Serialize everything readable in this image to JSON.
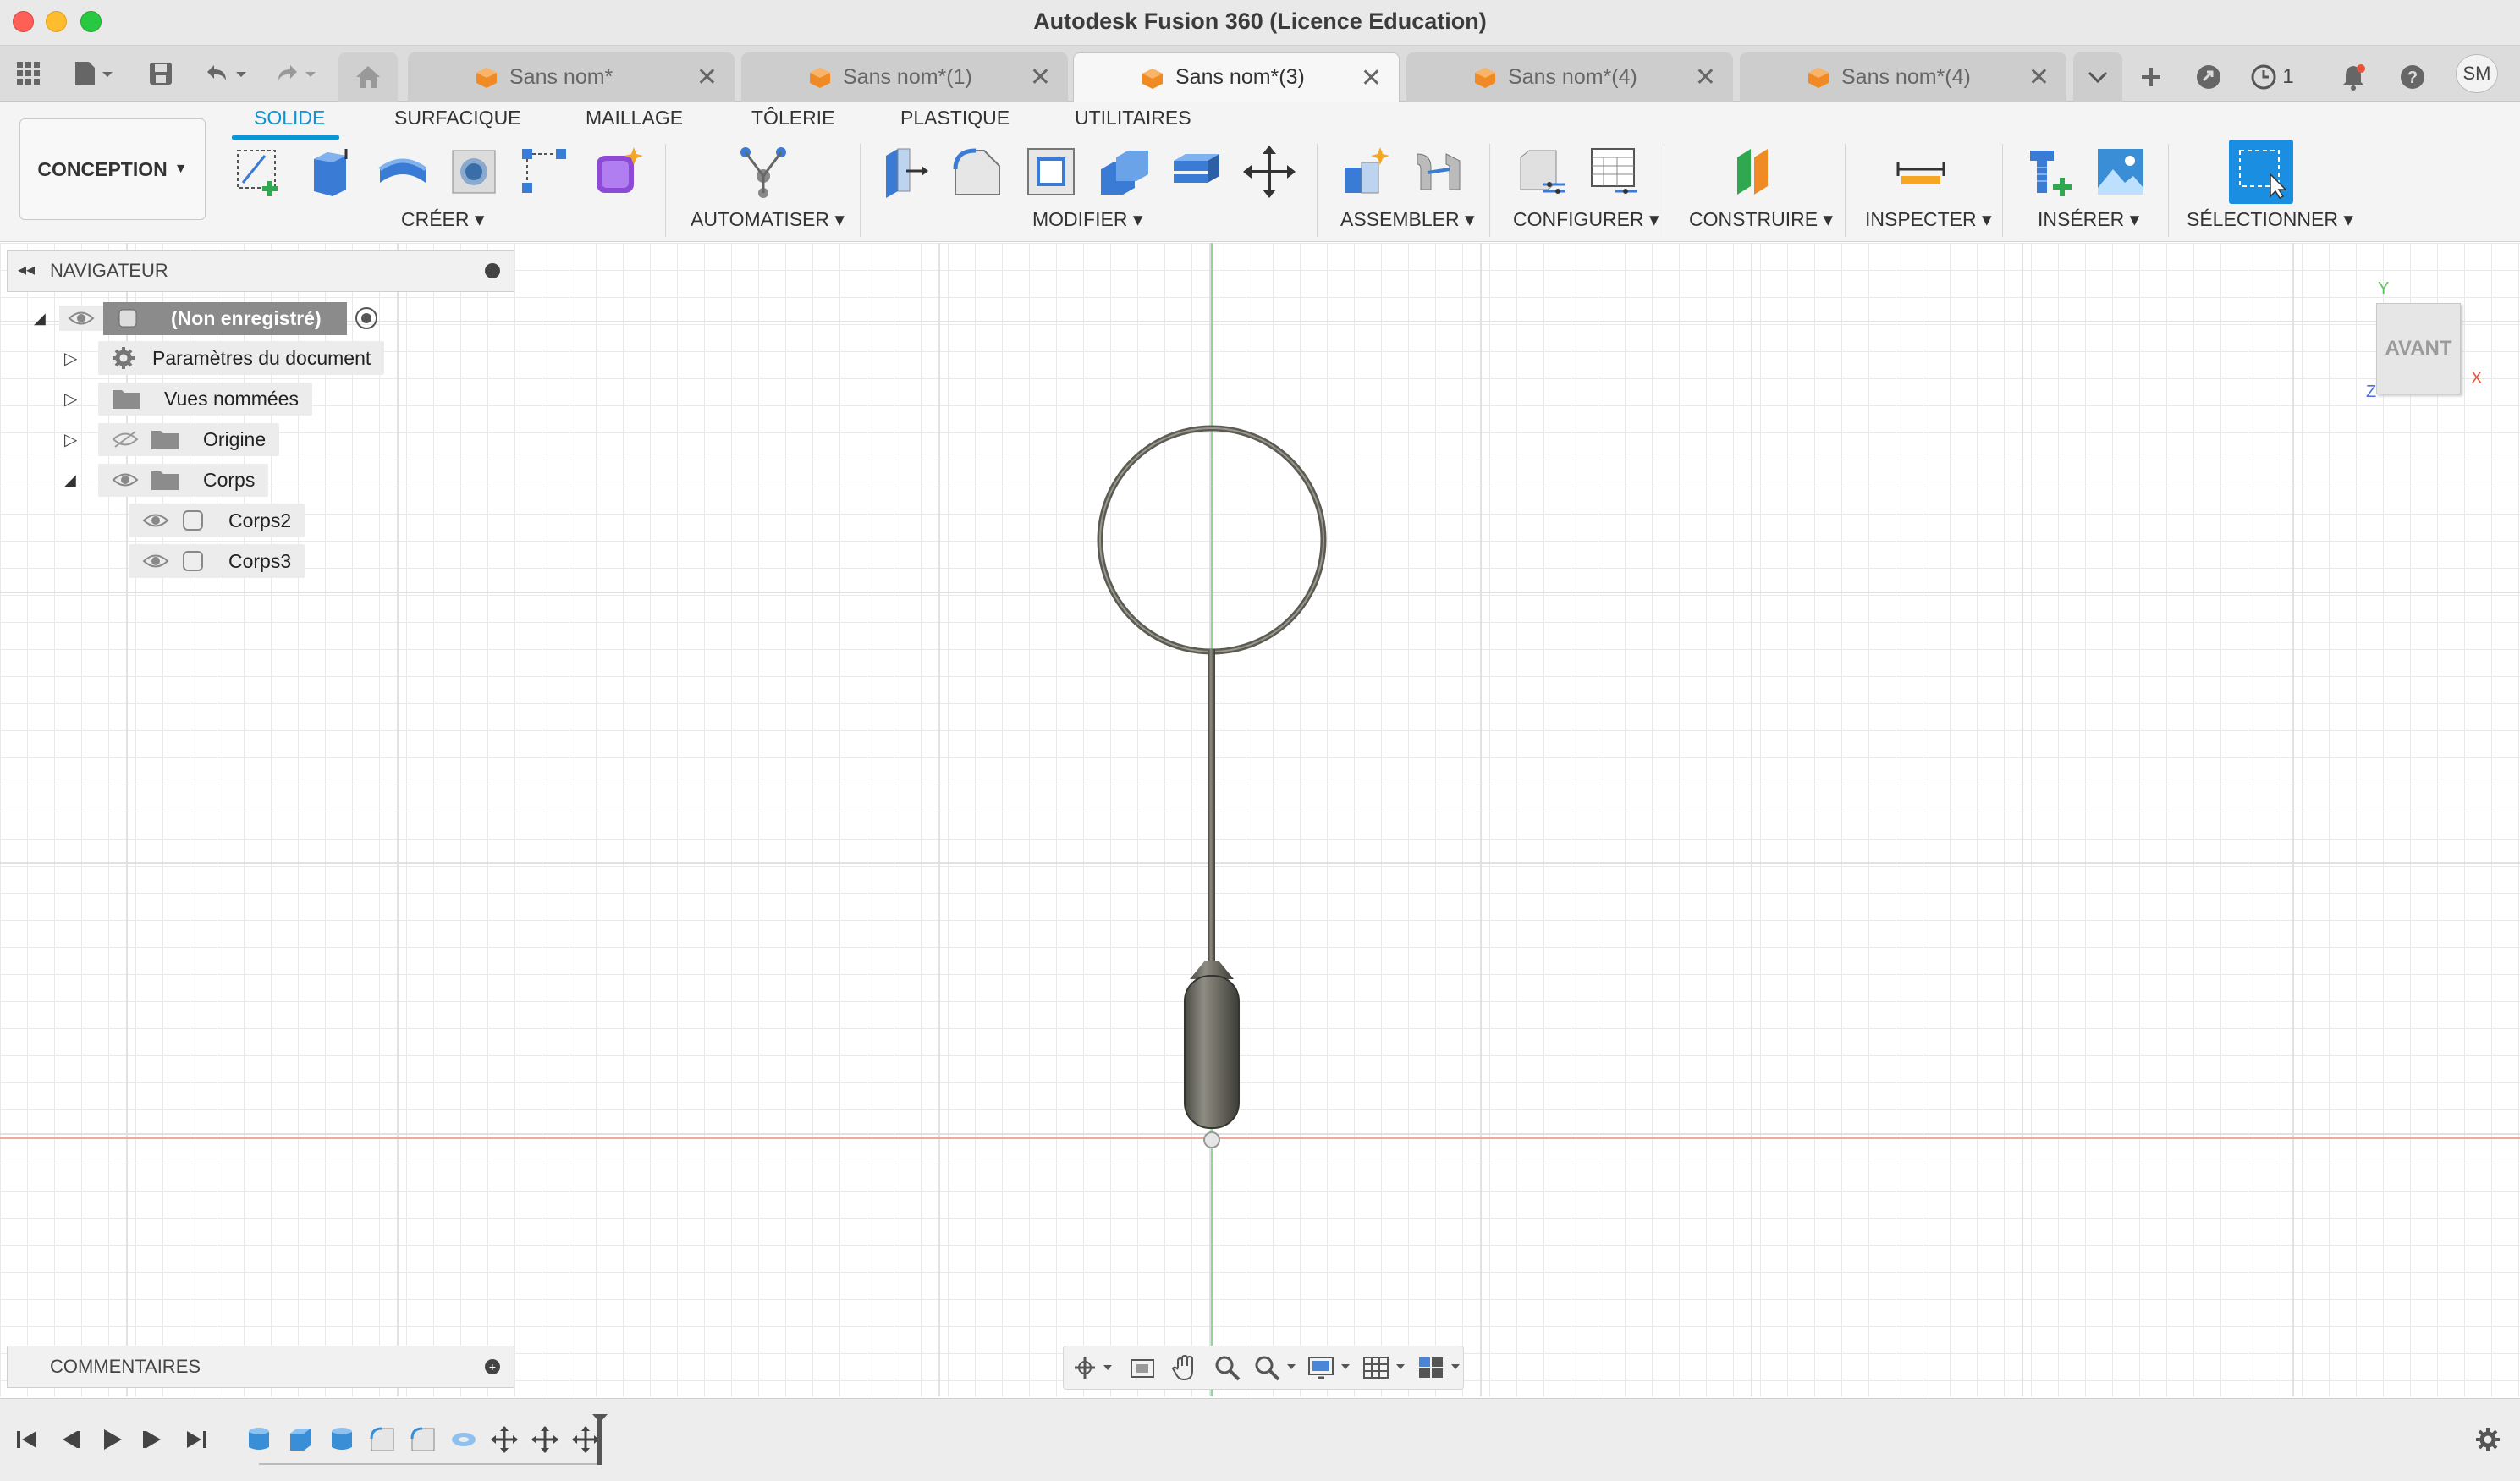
{
  "window": {
    "title": "Autodesk Fusion 360 (Licence Education)"
  },
  "tabs": [
    {
      "label": "Sans nom*",
      "active": false
    },
    {
      "label": "Sans nom*(1)",
      "active": false
    },
    {
      "label": "Sans nom*(3)",
      "active": true
    },
    {
      "label": "Sans nom*(4)",
      "active": false
    },
    {
      "label": "Sans nom*(4)",
      "active": false
    }
  ],
  "status": {
    "jobs_count": "1",
    "user_initials": "SM"
  },
  "toolbar": {
    "workspace": "CONCEPTION",
    "ribbon_tabs": [
      "SOLIDE",
      "SURFACIQUE",
      "MAILLAGE",
      "TÔLERIE",
      "PLASTIQUE",
      "UTILITAIRES"
    ],
    "groups": {
      "create": "CRÉER",
      "automate": "AUTOMATISER",
      "modify": "MODIFIER",
      "assemble": "ASSEMBLER",
      "configure": "CONFIGURER",
      "construct": "CONSTRUIRE",
      "inspect": "INSPECTER",
      "insert": "INSÉRER",
      "select": "SÉLECTIONNER"
    }
  },
  "navigator": {
    "title": "NAVIGATEUR",
    "root": "(Non enregistré)",
    "items": [
      {
        "label": "Paramètres du document"
      },
      {
        "label": "Vues nommées"
      },
      {
        "label": "Origine"
      },
      {
        "label": "Corps"
      }
    ],
    "bodies": [
      {
        "label": "Corps2"
      },
      {
        "label": "Corps3"
      }
    ]
  },
  "comments": {
    "title": "COMMENTAIRES"
  },
  "viewcube": {
    "face": "AVANT",
    "axis_x": "X",
    "axis_y": "Y",
    "axis_z": "Z"
  },
  "colors": {
    "accent": "#0a96d6",
    "tab_cube": "#f08a24",
    "axis_red": "#e8533c",
    "axis_green": "#5ac25a",
    "axis_blue": "#4a6ee0"
  }
}
